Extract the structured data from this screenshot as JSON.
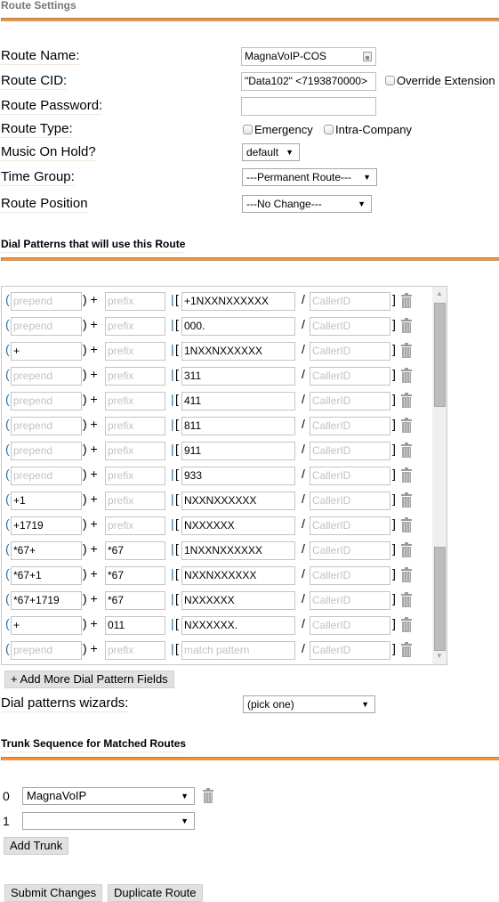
{
  "route_settings": {
    "title": "Route Settings",
    "route_name_label": "Route Name:",
    "route_name_value": "MagnaVoIP-COS",
    "route_cid_label": "Route CID:",
    "route_cid_value": "\"Data102\" <7193870000>",
    "override_extension_label": "Override Extension",
    "route_password_label": "Route Password:",
    "route_password_value": "",
    "route_type_label": "Route Type:",
    "emergency_label": "Emergency",
    "intra_company_label": "Intra-Company",
    "music_on_hold_label": "Music On Hold?",
    "music_on_hold_value": "default",
    "time_group_label": "Time Group:",
    "time_group_value": "---Permanent Route---",
    "route_position_label": "Route Position",
    "route_position_value": "---No Change---"
  },
  "dial_patterns": {
    "title": "Dial Patterns that will use this Route",
    "placeholders": {
      "prepend": "prepend",
      "prefix": "prefix",
      "match": "match pattern",
      "callerid": "CallerID"
    },
    "symbols": {
      "open_paren": "(",
      "close_paren_plus": ") +",
      "pipe": "|",
      "open_bracket": "[",
      "slash": "/",
      "close_bracket": "]"
    },
    "rows": [
      {
        "prepend": "",
        "prefix": "",
        "match": "+1NXXNXXXXXX",
        "callerid": ""
      },
      {
        "prepend": "",
        "prefix": "",
        "match": "000.",
        "callerid": ""
      },
      {
        "prepend": "+",
        "prefix": "",
        "match": "1NXXNXXXXXX",
        "callerid": ""
      },
      {
        "prepend": "",
        "prefix": "",
        "match": "311",
        "callerid": ""
      },
      {
        "prepend": "",
        "prefix": "",
        "match": "411",
        "callerid": ""
      },
      {
        "prepend": "",
        "prefix": "",
        "match": "811",
        "callerid": ""
      },
      {
        "prepend": "",
        "prefix": "",
        "match": "911",
        "callerid": ""
      },
      {
        "prepend": "",
        "prefix": "",
        "match": "933",
        "callerid": ""
      },
      {
        "prepend": "+1",
        "prefix": "",
        "match": "NXXNXXXXXX",
        "callerid": ""
      },
      {
        "prepend": "+1719",
        "prefix": "",
        "match": "NXXXXXX",
        "callerid": ""
      },
      {
        "prepend": "*67+",
        "prefix": "*67",
        "match": "1NXXNXXXXXX",
        "callerid": ""
      },
      {
        "prepend": "*67+1",
        "prefix": "*67",
        "match": "NXXNXXXXXX",
        "callerid": ""
      },
      {
        "prepend": "*67+1719",
        "prefix": "*67",
        "match": "NXXXXXX",
        "callerid": ""
      },
      {
        "prepend": "+",
        "prefix": "011",
        "match": "NXXXXXX.",
        "callerid": ""
      },
      {
        "prepend": "",
        "prefix": "",
        "match": "",
        "callerid": ""
      }
    ],
    "add_more_label": "+ Add More Dial Pattern Fields",
    "wizards_label": "Dial patterns wizards:",
    "wizards_value": "(pick one)"
  },
  "trunk_sequence": {
    "title": "Trunk Sequence for Matched Routes",
    "trunks": [
      {
        "index": "0",
        "value": "MagnaVoIP"
      },
      {
        "index": "1",
        "value": ""
      }
    ],
    "add_trunk_label": "Add Trunk"
  },
  "actions": {
    "submit_label": "Submit Changes",
    "duplicate_label": "Duplicate Route"
  },
  "icons": {
    "dropdown_arrow": "▼",
    "scroll_up": "▲",
    "scroll_down": "▼"
  },
  "colors": {
    "accent_orange": "#f7922d",
    "bracket_blue": "#1f6fa8"
  }
}
